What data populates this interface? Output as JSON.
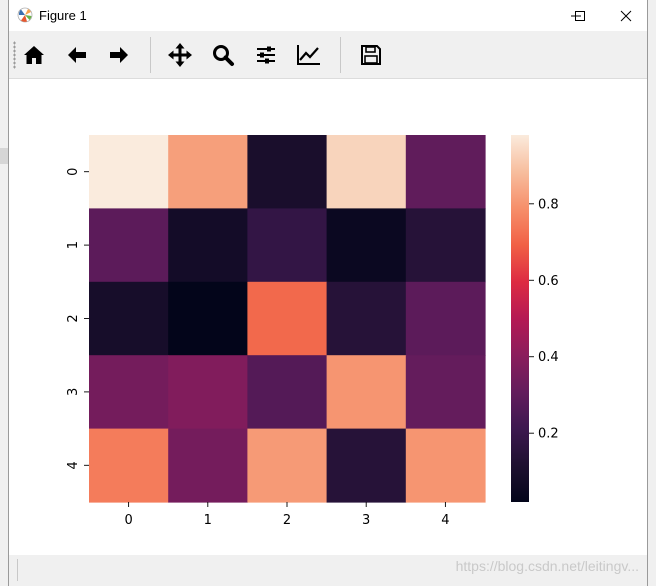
{
  "window": {
    "title": "Figure 1"
  },
  "toolbar": {
    "buttons": [
      {
        "name": "home-icon"
      },
      {
        "name": "back-arrow-icon"
      },
      {
        "name": "forward-arrow-icon"
      },
      {
        "name": "pan-icon"
      },
      {
        "name": "zoom-icon"
      },
      {
        "name": "configure-subplots-icon"
      },
      {
        "name": "edit-axis-icon"
      },
      {
        "name": "save-icon"
      }
    ]
  },
  "chart_data": {
    "type": "heatmap",
    "row_labels": [
      "0",
      "1",
      "2",
      "3",
      "4"
    ],
    "col_labels": [
      "0",
      "1",
      "2",
      "3",
      "4"
    ],
    "values": [
      [
        0.98,
        0.82,
        0.1,
        0.93,
        0.3
      ],
      [
        0.29,
        0.08,
        0.18,
        0.05,
        0.14
      ],
      [
        0.09,
        0.02,
        0.71,
        0.14,
        0.29
      ],
      [
        0.35,
        0.38,
        0.27,
        0.8,
        0.31
      ],
      [
        0.75,
        0.35,
        0.81,
        0.14,
        0.8
      ]
    ],
    "vmin": 0.02,
    "vmax": 0.98,
    "colormap": "rocket",
    "colorbar_ticks": [
      "0.2",
      "0.4",
      "0.6",
      "0.8"
    ]
  },
  "status": {
    "watermark": "https://blog.csdn.net/leitingv..."
  }
}
